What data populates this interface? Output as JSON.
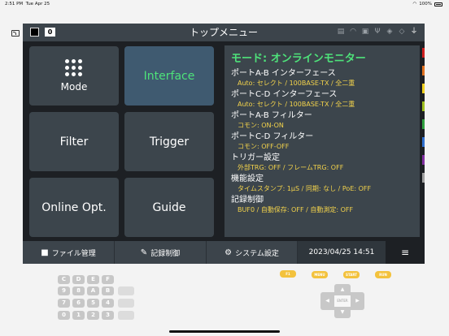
{
  "ios_status": {
    "time": "2:51 PM",
    "date": "Tue Apr 25",
    "battery": "100%"
  },
  "device": {
    "title": "トップメニュー",
    "channel_badge": "0",
    "menu_tiles": [
      {
        "label": "Mode",
        "active": false
      },
      {
        "label": "Interface",
        "active": true
      },
      {
        "label": "Filter",
        "active": false
      },
      {
        "label": "Trigger",
        "active": false
      },
      {
        "label": "Online Opt.",
        "active": false
      },
      {
        "label": "Guide",
        "active": false
      }
    ],
    "info": {
      "title": "モード: オンラインモニター",
      "items": [
        {
          "heading": "ポートA-B インターフェース",
          "value": "Auto: セレクト / 100BASE-TX / 全二重"
        },
        {
          "heading": "ポートC-D インターフェース",
          "value": "Auto: セレクト / 100BASE-TX / 全二重"
        },
        {
          "heading": "ポートA-B フィルター",
          "value": "コモン: ON-ON"
        },
        {
          "heading": "ポートC-D フィルター",
          "value": "コモン: OFF-OFF"
        },
        {
          "heading": "トリガー設定",
          "value": "外部TRG: OFF / フレームTRG: OFF"
        },
        {
          "heading": "機能設定",
          "value": "タイムスタンプ: 1μS / 同期: なし / PoE: OFF"
        },
        {
          "heading": "記録制御",
          "value": "BUF0 / 自動保存: OFF / 自動測定: OFF"
        }
      ]
    },
    "strip_colors": [
      "#d02020",
      "#e07020",
      "#f0d020",
      "#a0c020",
      "#30a040",
      "#3070d0",
      "#8030a0",
      "#a0a0a0"
    ],
    "bottom": {
      "file_label": "ファイル管理",
      "record_label": "記録制御",
      "system_label": "システム設定",
      "datetime": "2023/04/25  14:51"
    }
  },
  "keypad": {
    "keys": [
      "C",
      "D",
      "E",
      "F",
      "9",
      "8",
      "A",
      "B",
      "7",
      "6",
      "5",
      "4",
      "0",
      "1",
      "2",
      "3"
    ],
    "fkeys": [
      "F1",
      "MENU",
      "START",
      "RUN"
    ],
    "enter": "ENTER"
  }
}
